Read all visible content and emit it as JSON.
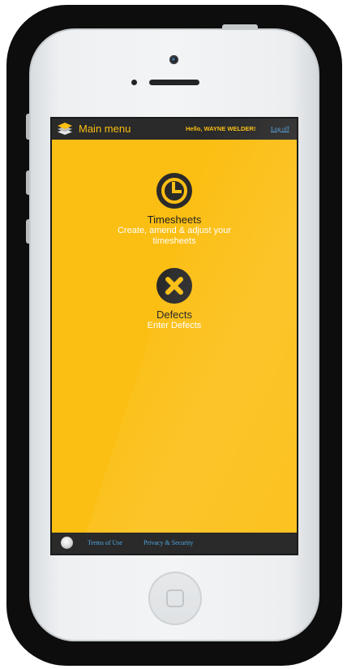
{
  "header": {
    "icon": "layers-icon",
    "title": "Main menu",
    "greeting": "Hello, WAYNE WELDER!",
    "logoff_label": "Log off"
  },
  "menu": {
    "items": [
      {
        "icon": "clock-icon",
        "title": "Timesheets",
        "description": "Create, amend & adjust your timesheets"
      },
      {
        "icon": "close-icon",
        "title": "Defects",
        "description": "Enter Defects"
      }
    ]
  },
  "footer": {
    "logo": "globe-icon",
    "links": [
      {
        "label": "Terms of Use"
      },
      {
        "label": "Privacy & Security"
      }
    ]
  },
  "colors": {
    "accent": "#fbbe12",
    "bar": "#2a2a2a",
    "link": "#52a6e0",
    "icon": "#2a2a2a"
  }
}
